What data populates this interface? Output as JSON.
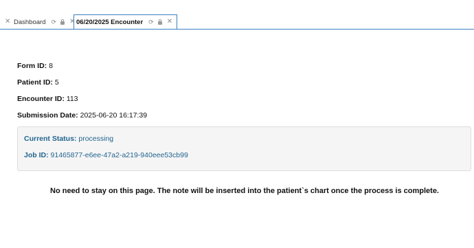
{
  "tabs": [
    {
      "label": "Dashboard",
      "active": false
    },
    {
      "label": "06/20/2025 Encounter",
      "active": true
    }
  ],
  "icons": {
    "close": "close-icon",
    "refresh": "refresh-icon",
    "lock": "lock-icon"
  },
  "fields": {
    "form_id": {
      "label": "Form ID:",
      "value": "8"
    },
    "patient_id": {
      "label": "Patient ID:",
      "value": "5"
    },
    "encounter_id": {
      "label": "Encounter ID:",
      "value": "113"
    },
    "submission_date": {
      "label": "Submission Date:",
      "value": "2025-06-20 16:17:39"
    }
  },
  "status": {
    "current_status_label": "Current Status:",
    "current_status_value": "processing",
    "job_id_label": "Job ID:",
    "job_id_value": "91465877-e6ee-47a2-a219-940eee53cb99"
  },
  "note": "No need to stay on this page. The note will be inserted into the patient`s chart once the process is complete.",
  "colors": {
    "accent": "#3d7fbf",
    "status_text": "#21658f",
    "status_bg": "#f5f5f5"
  }
}
